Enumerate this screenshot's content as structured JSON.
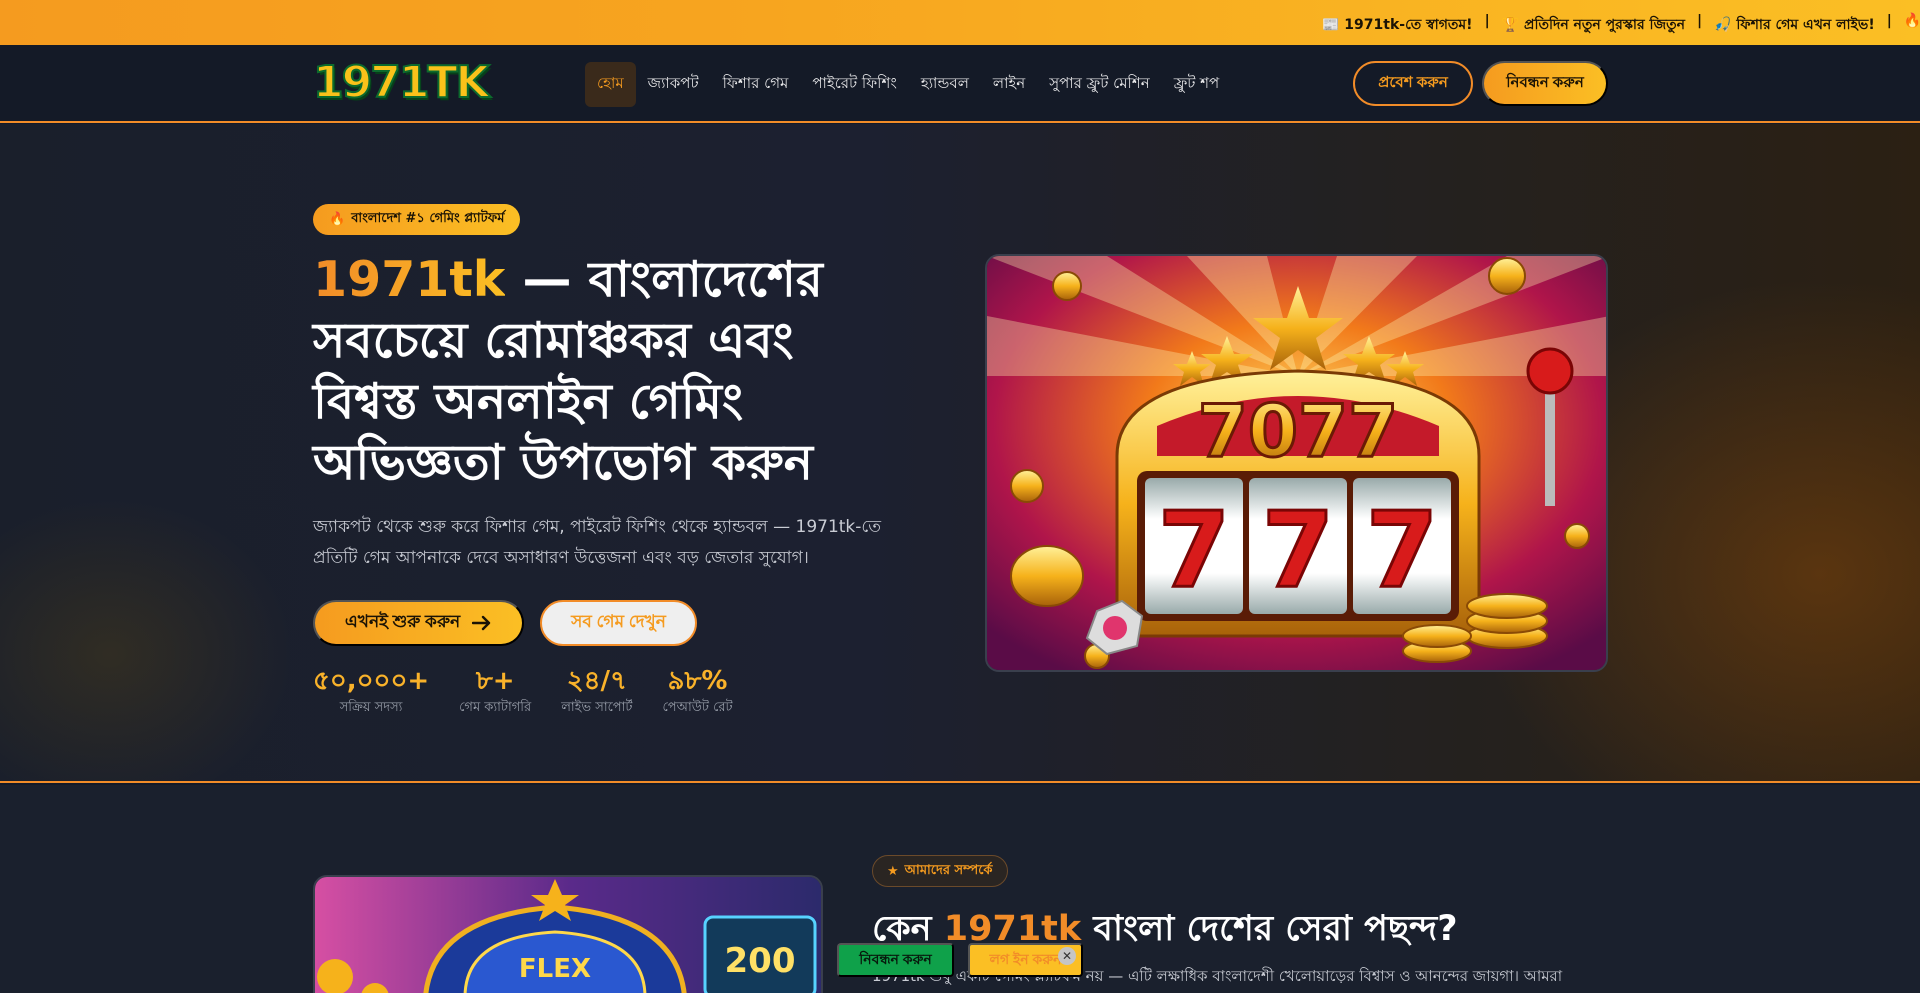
{
  "ticker": {
    "items": [
      "📰 1971tk-তে স্বাগতম!",
      "🏆 প্রতিদিন নতুন পুরস্কার জিতুন",
      "🎣 ফিশার গেম এখন লাইভ!",
      "🔥"
    ],
    "separator": "|"
  },
  "header": {
    "logo": "1971TK",
    "nav": [
      "হোম",
      "জ্যাকপট",
      "ফিশার গেম",
      "পাইরেট ফিশিং",
      "হ্যান্ডবল",
      "লাইন",
      "সুপার ফ্রুট মেশিন",
      "ফ্রুট শপ"
    ],
    "active_nav": 0,
    "login_label": "প্রবেশ করুন",
    "register_label": "নিবন্ধন করুন"
  },
  "hero": {
    "badge": "বাংলাদেশ #১ গেমিং প্ল্যাটফর্ম",
    "badge_icon": "fire-icon",
    "title_accent": "1971tk",
    "title_rest": " — বাংলাদেশের সবচেয়ে রোমাঞ্চকর এবং বিশ্বস্ত অনলাইন গেমিং অভিজ্ঞতা উপভোগ করুন",
    "description": "জ্যাকপট থেকে শুরু করে ফিশার গেম, পাইরেট ফিশিং থেকে হ্যান্ডবল — 1971tk-তে প্রতিটি গেম আপনাকে দেবে অসাধারণ উত্তেজনা এবং বড় জেতার সুযোগ।",
    "start_label": "এখনই শুরু করুন",
    "all_games_label": "সব গেম দেখুন",
    "stats": [
      {
        "value": "৫০,০০০+",
        "label": "সক্রিয় সদস্য"
      },
      {
        "value": "৮+",
        "label": "গেম ক্যাটাগরি"
      },
      {
        "value": "২৪/৭",
        "label": "লাইভ সাপোর্ট"
      },
      {
        "value": "৯৮%",
        "label": "পেআউট রেট"
      }
    ],
    "image_text": "7077"
  },
  "about": {
    "badge": "আমাদের সম্পর্কে",
    "title_pre": "কেন ",
    "title_accent": "1971tk",
    "title_post": " বাংলা দেশের সেরা পছন্দ?",
    "text": "1971tk শুধু একটি গেমিং প্ল্যাটফর্ম নয় — এটি লক্ষাধিক বাংলাদেশী খেলোয়াড়ের বিশ্বাস ও আনন্দের জায়গা। আমরা",
    "image_text": "200"
  },
  "floating": {
    "register_label": "নিবন্ধন করুন",
    "login_label": "লগ ইন করুন",
    "close_icon": "✕"
  },
  "colors": {
    "accent": "#f28c28",
    "gold": "#fbbf24",
    "background": "#141a27",
    "float_green": "#0fa14a"
  }
}
